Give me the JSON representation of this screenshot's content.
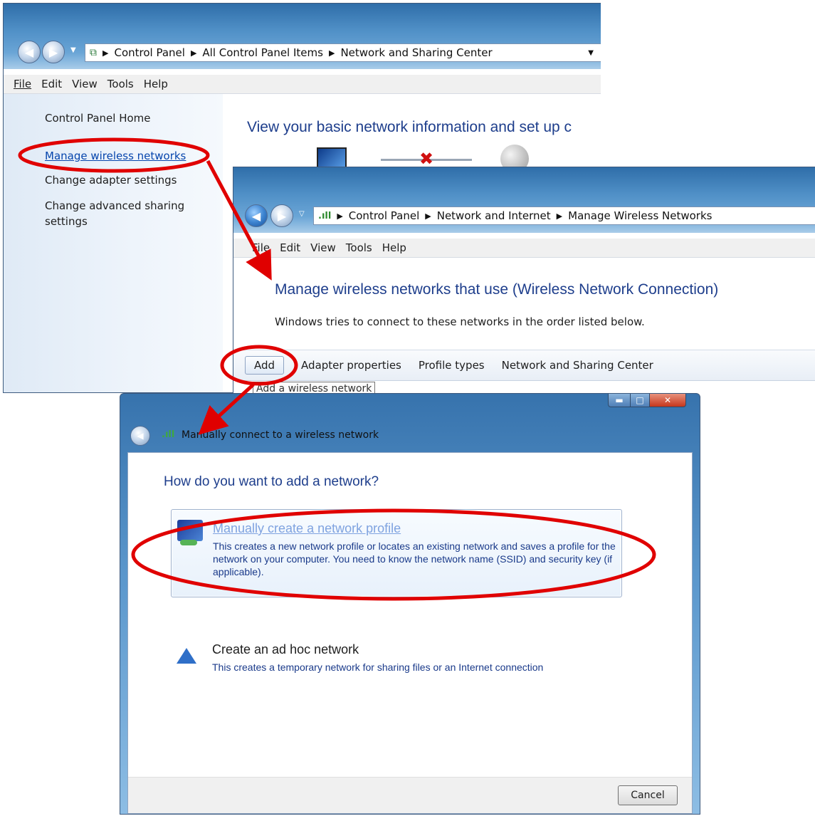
{
  "window1": {
    "breadcrumb": [
      "Control Panel",
      "All Control Panel Items",
      "Network and Sharing Center"
    ],
    "menu": [
      "File",
      "Edit",
      "View",
      "Tools",
      "Help"
    ],
    "sidebar": {
      "home": "Control Panel Home",
      "manage_wireless": "Manage wireless networks",
      "adapter": "Change adapter settings",
      "advanced_line1": "Change advanced sharing",
      "advanced_line2": "settings"
    },
    "heading": "View your basic network information and set up c"
  },
  "window2": {
    "breadcrumb": [
      "Control Panel",
      "Network and Internet",
      "Manage Wireless Networks"
    ],
    "menu": [
      "File",
      "Edit",
      "View",
      "Tools",
      "Help"
    ],
    "heading": "Manage wireless networks that use (Wireless Network Connection)",
    "subtext": "Windows tries to connect to these networks in the order listed below.",
    "toolbar": {
      "add": "Add",
      "adapter_properties": "Adapter properties",
      "profile_types": "Profile types",
      "network_sharing_center": "Network and Sharing Center"
    },
    "tooltip": "Add a wireless network"
  },
  "dialog": {
    "title": "Manually connect to a wireless network",
    "question": "How do you want to add a network?",
    "option1": {
      "title": "Manually create a network profile",
      "description": "This creates a new network profile or locates an existing network and saves a profile for the network on your computer. You need to know the network name (SSID) and security key (if applicable)."
    },
    "option2": {
      "title": "Create an ad hoc network",
      "description": "This creates a temporary network for sharing files or an Internet connection"
    },
    "cancel": "Cancel"
  },
  "colors": {
    "annotation": "#e00000",
    "heading_blue": "#1e3e8c",
    "link_blue": "#0645ad"
  }
}
